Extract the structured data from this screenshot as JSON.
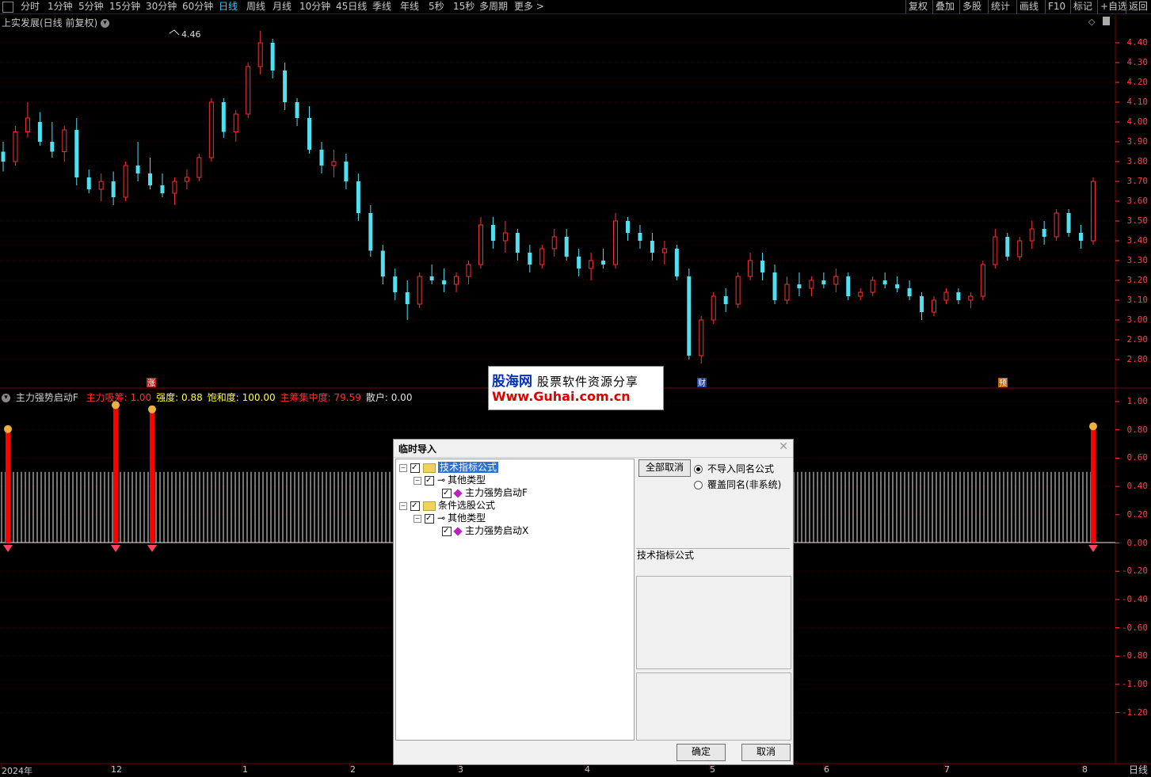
{
  "toolbar": {
    "left_items": [
      "分时",
      "1分钟",
      "5分钟",
      "15分钟",
      "30分钟",
      "60分钟",
      "日线",
      "周线",
      "月线",
      "10分钟",
      "45日线",
      "季线",
      "年线",
      "5秒",
      "15秒",
      "多周期",
      "更多 >"
    ],
    "active": "日线",
    "right_items": [
      "复权",
      "叠加",
      "多股",
      "统计",
      "画线",
      "F10",
      "标记",
      "+自选",
      "返回"
    ]
  },
  "main_chart": {
    "title": "上实发展(日线 前复权)",
    "high_label": "4.46",
    "y_ticks": [
      "4.40",
      "4.30",
      "4.20",
      "4.10",
      "4.00",
      "3.90",
      "3.80",
      "3.70",
      "3.60",
      "3.50",
      "3.40",
      "3.30",
      "3.20",
      "3.10",
      "3.00",
      "2.90",
      "2.80"
    ],
    "tags": [
      {
        "text": "涨",
        "color": "#c02020"
      },
      {
        "text": "财",
        "color": "#2040a0"
      },
      {
        "text": "预",
        "color": "#c06000"
      }
    ]
  },
  "indicator": {
    "name": "主力强势启动F",
    "fields": [
      {
        "label": "主力吸筹",
        "value": "1.00",
        "color": "#ff3030"
      },
      {
        "label": "强度",
        "value": "0.88",
        "color": "#ffff40"
      },
      {
        "label": "饱和度",
        "value": "100.00",
        "color": "#ffff40"
      },
      {
        "label": "主筹集中度",
        "value": "79.59",
        "color": "#ff3030"
      },
      {
        "label": "散户",
        "value": "0.00",
        "color": "#e0e0e0"
      }
    ],
    "y_ticks": [
      "1.00",
      "0.80",
      "0.60",
      "0.40",
      "0.20",
      "0.00",
      "-0.20",
      "-0.40",
      "-0.60",
      "-0.80",
      "-1.00",
      "-1.20"
    ]
  },
  "date_axis": [
    "2024年",
    "12",
    "1",
    "2",
    "3",
    "4",
    "5",
    "6",
    "7",
    "8"
  ],
  "period_label": "日线",
  "watermark": {
    "brand": "股海网",
    "slogan": "股票软件资源分享",
    "url": "Www.Guhai.com.cn"
  },
  "dialog": {
    "title": "临时导入",
    "tree": [
      {
        "label": "技术指标公式",
        "type": "folder",
        "selected": true
      },
      {
        "label": "其他类型",
        "type": "group"
      },
      {
        "label": "主力强势启动F",
        "type": "item"
      },
      {
        "label": "条件选股公式",
        "type": "folder"
      },
      {
        "label": "其他类型",
        "type": "group"
      },
      {
        "label": "主力强势启动X",
        "type": "item"
      }
    ],
    "cancel_all_label": "全部取消",
    "radio_options": [
      {
        "label": "不导入同名公式",
        "checked": true
      },
      {
        "label": "覆盖同名(非系统)",
        "checked": false
      }
    ],
    "info_label": "技术指标公式",
    "ok_label": "确定",
    "cancel_label": "取消"
  },
  "colors": {
    "up": "#ff3030",
    "down": "#50e0f0",
    "axis": "#ff4040",
    "grid": "#7a0000"
  },
  "chart_data": {
    "type": "candlestick",
    "title": "上实发展(日线 前复权)",
    "ylim": [
      2.75,
      4.48
    ],
    "x_labels": [
      "2024年",
      "12",
      "1",
      "2",
      "3",
      "4",
      "5",
      "6",
      "7",
      "8"
    ],
    "ohlc": [
      [
        3.85,
        3.9,
        3.75,
        3.8
      ],
      [
        3.8,
        3.98,
        3.78,
        3.95
      ],
      [
        3.95,
        4.1,
        3.92,
        4.02
      ],
      [
        4.0,
        4.05,
        3.88,
        3.9
      ],
      [
        3.9,
        4.0,
        3.82,
        3.85
      ],
      [
        3.85,
        3.98,
        3.8,
        3.96
      ],
      [
        3.96,
        4.02,
        3.68,
        3.72
      ],
      [
        3.72,
        3.76,
        3.64,
        3.66
      ],
      [
        3.66,
        3.74,
        3.6,
        3.7
      ],
      [
        3.7,
        3.75,
        3.58,
        3.62
      ],
      [
        3.62,
        3.8,
        3.6,
        3.78
      ],
      [
        3.78,
        3.9,
        3.7,
        3.74
      ],
      [
        3.74,
        3.82,
        3.66,
        3.68
      ],
      [
        3.68,
        3.74,
        3.62,
        3.64
      ],
      [
        3.64,
        3.72,
        3.58,
        3.7
      ],
      [
        3.7,
        3.76,
        3.66,
        3.72
      ],
      [
        3.72,
        3.84,
        3.7,
        3.82
      ],
      [
        3.82,
        4.12,
        3.8,
        4.1
      ],
      [
        4.1,
        4.12,
        3.92,
        3.95
      ],
      [
        3.95,
        4.06,
        3.9,
        4.04
      ],
      [
        4.04,
        4.3,
        4.02,
        4.28
      ],
      [
        4.28,
        4.46,
        4.24,
        4.4
      ],
      [
        4.4,
        4.42,
        4.22,
        4.26
      ],
      [
        4.26,
        4.3,
        4.06,
        4.1
      ],
      [
        4.1,
        4.12,
        3.98,
        4.02
      ],
      [
        4.02,
        4.08,
        3.84,
        3.86
      ],
      [
        3.86,
        3.9,
        3.74,
        3.78
      ],
      [
        3.78,
        3.86,
        3.72,
        3.8
      ],
      [
        3.8,
        3.84,
        3.66,
        3.7
      ],
      [
        3.7,
        3.74,
        3.5,
        3.54
      ],
      [
        3.54,
        3.58,
        3.32,
        3.35
      ],
      [
        3.35,
        3.38,
        3.18,
        3.22
      ],
      [
        3.22,
        3.26,
        3.1,
        3.14
      ],
      [
        3.14,
        3.2,
        3.0,
        3.08
      ],
      [
        3.08,
        3.24,
        3.06,
        3.22
      ],
      [
        3.22,
        3.28,
        3.18,
        3.2
      ],
      [
        3.2,
        3.26,
        3.14,
        3.18
      ],
      [
        3.18,
        3.24,
        3.14,
        3.22
      ],
      [
        3.22,
        3.3,
        3.18,
        3.28
      ],
      [
        3.28,
        3.52,
        3.26,
        3.48
      ],
      [
        3.48,
        3.52,
        3.36,
        3.4
      ],
      [
        3.4,
        3.5,
        3.34,
        3.44
      ],
      [
        3.44,
        3.46,
        3.3,
        3.34
      ],
      [
        3.34,
        3.38,
        3.24,
        3.28
      ],
      [
        3.28,
        3.38,
        3.26,
        3.36
      ],
      [
        3.36,
        3.46,
        3.32,
        3.42
      ],
      [
        3.42,
        3.46,
        3.3,
        3.32
      ],
      [
        3.32,
        3.36,
        3.22,
        3.26
      ],
      [
        3.26,
        3.34,
        3.2,
        3.3
      ],
      [
        3.3,
        3.36,
        3.26,
        3.28
      ],
      [
        3.28,
        3.54,
        3.26,
        3.5
      ],
      [
        3.5,
        3.52,
        3.4,
        3.44
      ],
      [
        3.44,
        3.48,
        3.36,
        3.4
      ],
      [
        3.4,
        3.44,
        3.3,
        3.34
      ],
      [
        3.34,
        3.4,
        3.28,
        3.36
      ],
      [
        3.36,
        3.38,
        3.2,
        3.22
      ],
      [
        3.22,
        3.26,
        2.8,
        2.82
      ],
      [
        2.82,
        3.02,
        2.78,
        3.0
      ],
      [
        3.0,
        3.14,
        2.98,
        3.12
      ],
      [
        3.12,
        3.16,
        3.04,
        3.08
      ],
      [
        3.08,
        3.24,
        3.06,
        3.22
      ],
      [
        3.22,
        3.34,
        3.2,
        3.3
      ],
      [
        3.3,
        3.34,
        3.2,
        3.24
      ],
      [
        3.24,
        3.28,
        3.08,
        3.1
      ],
      [
        3.1,
        3.22,
        3.08,
        3.18
      ],
      [
        3.18,
        3.24,
        3.12,
        3.16
      ],
      [
        3.16,
        3.22,
        3.12,
        3.2
      ],
      [
        3.2,
        3.24,
        3.16,
        3.18
      ],
      [
        3.18,
        3.26,
        3.14,
        3.22
      ],
      [
        3.22,
        3.24,
        3.1,
        3.12
      ],
      [
        3.12,
        3.16,
        3.1,
        3.14
      ],
      [
        3.14,
        3.22,
        3.12,
        3.2
      ],
      [
        3.2,
        3.24,
        3.16,
        3.18
      ],
      [
        3.18,
        3.22,
        3.14,
        3.16
      ],
      [
        3.16,
        3.2,
        3.1,
        3.12
      ],
      [
        3.12,
        3.14,
        3.0,
        3.04
      ],
      [
        3.04,
        3.12,
        3.02,
        3.1
      ],
      [
        3.1,
        3.16,
        3.08,
        3.14
      ],
      [
        3.14,
        3.16,
        3.08,
        3.1
      ],
      [
        3.1,
        3.14,
        3.06,
        3.12
      ],
      [
        3.12,
        3.3,
        3.1,
        3.28
      ],
      [
        3.28,
        3.46,
        3.26,
        3.42
      ],
      [
        3.42,
        3.44,
        3.3,
        3.32
      ],
      [
        3.32,
        3.42,
        3.3,
        3.4
      ],
      [
        3.4,
        3.5,
        3.36,
        3.46
      ],
      [
        3.46,
        3.5,
        3.38,
        3.42
      ],
      [
        3.42,
        3.56,
        3.4,
        3.54
      ],
      [
        3.54,
        3.56,
        3.42,
        3.44
      ],
      [
        3.44,
        3.48,
        3.36,
        3.4
      ],
      [
        3.4,
        3.72,
        3.38,
        3.7
      ]
    ]
  }
}
